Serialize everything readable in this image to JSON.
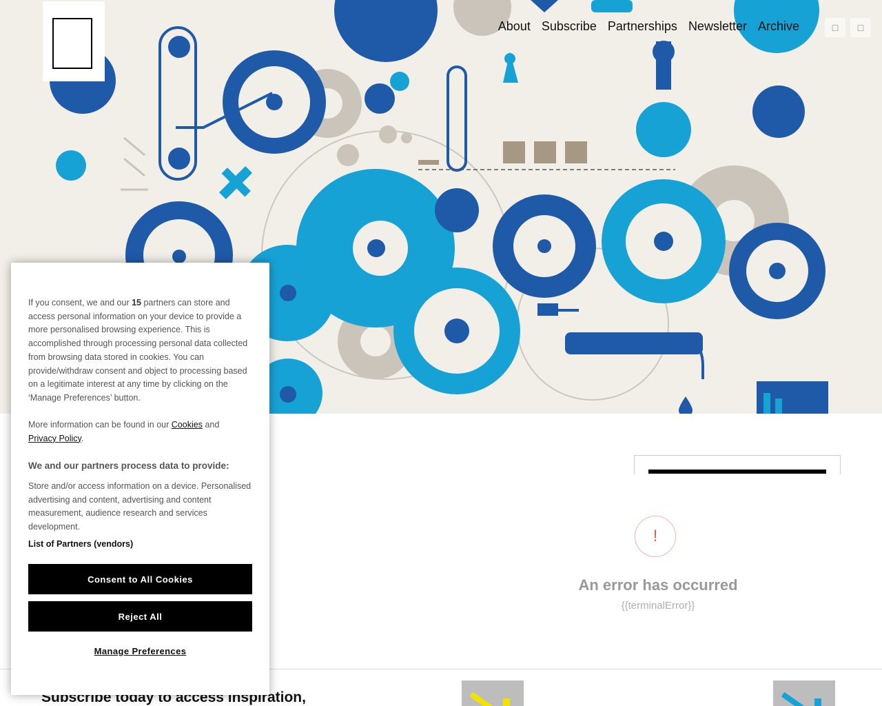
{
  "nav": {
    "items": [
      "About",
      "Subscribe",
      "Partnerships",
      "Newsletter",
      "Archive"
    ],
    "icons": [
      "search-icon",
      "user-icon"
    ]
  },
  "hero": {
    "icon": "gears-illustration",
    "colors": {
      "dark_blue": "#1e5aa8",
      "cyan": "#17a2d6",
      "gray": "#c9c3ba",
      "background": "#f1efe8"
    }
  },
  "ad": {
    "error_symbol": "!",
    "error_title": "An error has occurred",
    "error_sub": "{{terminalError}}"
  },
  "footer_teaser": {
    "subscribe_heading": "Subscribe today to access inspiration,"
  },
  "consent": {
    "p1_before": "If you consent, we and our ",
    "partner_count": "15",
    "p1_after": " partners can store and access personal information on your device to provide a more personalised browsing experience. This is accomplished through processing personal data collected from browsing data stored in cookies. You can provide/withdraw consent and object to processing based on a legitimate interest at any time by clicking on the ‘Manage Preferences’ button.",
    "p2_before": "More information can be found in our ",
    "cookies_link": "Cookies",
    "p2_and": " and",
    "privacy_link": "Privacy Policy",
    "p2_end": ".",
    "purposes_heading": "We and our partners process data to provide:",
    "purposes_text": "Store and/or access information on a device. Personalised advertising and content, advertising and content measurement, audience research and services development.",
    "partners_link": "List of Partners (vendors)",
    "consent_button": "Consent to All Cookies",
    "reject_button": "Reject All",
    "manage_button": "Manage Preferences"
  }
}
